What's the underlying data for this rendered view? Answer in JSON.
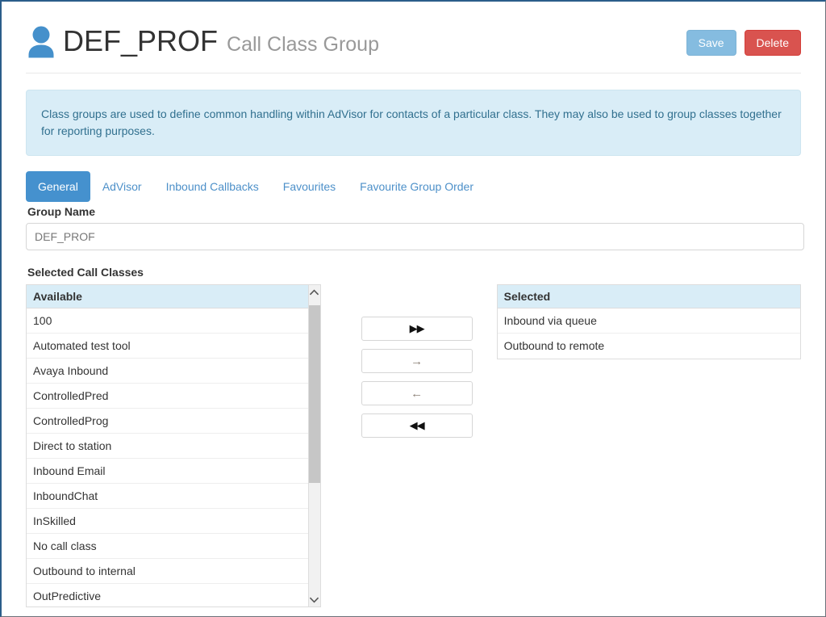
{
  "header": {
    "icon": "user-icon",
    "title": "DEF_PROF",
    "subtitle": "Call Class Group",
    "save_label": "Save",
    "delete_label": "Delete",
    "save_color": "#85bce0",
    "delete_color": "#d9534f"
  },
  "info_banner": {
    "text": "Class groups are used to define common handling within AdVisor for contacts of a particular class. They may also be used to group classes together for reporting purposes.",
    "background": "#d9edf7",
    "text_color": "#31708f"
  },
  "tabs": {
    "active_color": "#4591ce",
    "link_color": "#4d90c9",
    "items": [
      {
        "label": "General",
        "active": true
      },
      {
        "label": "AdVisor",
        "active": false
      },
      {
        "label": "Inbound Callbacks",
        "active": false
      },
      {
        "label": "Favourites",
        "active": false
      },
      {
        "label": "Favourite Group Order",
        "active": false
      }
    ]
  },
  "form": {
    "group_name_label": "Group Name",
    "group_name_value": "DEF_PROF",
    "group_name_placeholder": "Group Name"
  },
  "dual_list": {
    "section_label": "Selected Call Classes",
    "available": {
      "header": "Available",
      "items": [
        "100",
        "Automated test tool",
        "Avaya Inbound",
        "ControlledPred",
        "ControlledProg",
        "Direct to station",
        "Inbound Email",
        "InboundChat",
        "InSkilled",
        "No call class",
        "Outbound to internal",
        "OutPredictive"
      ]
    },
    "selected": {
      "header": "Selected",
      "items": [
        "Inbound via queue",
        "Outbound to remote"
      ]
    },
    "transfer_buttons": [
      {
        "name": "move-all-right-button",
        "glyph": "▶▶",
        "style": "strong"
      },
      {
        "name": "move-right-button",
        "glyph": "→",
        "style": "light"
      },
      {
        "name": "move-left-button",
        "glyph": "←",
        "style": "light"
      },
      {
        "name": "move-all-left-button",
        "glyph": "◀◀",
        "style": "strong"
      }
    ],
    "scrollbar": {
      "up_icon": "chevron-up-icon",
      "down_icon": "chevron-down-icon"
    }
  }
}
